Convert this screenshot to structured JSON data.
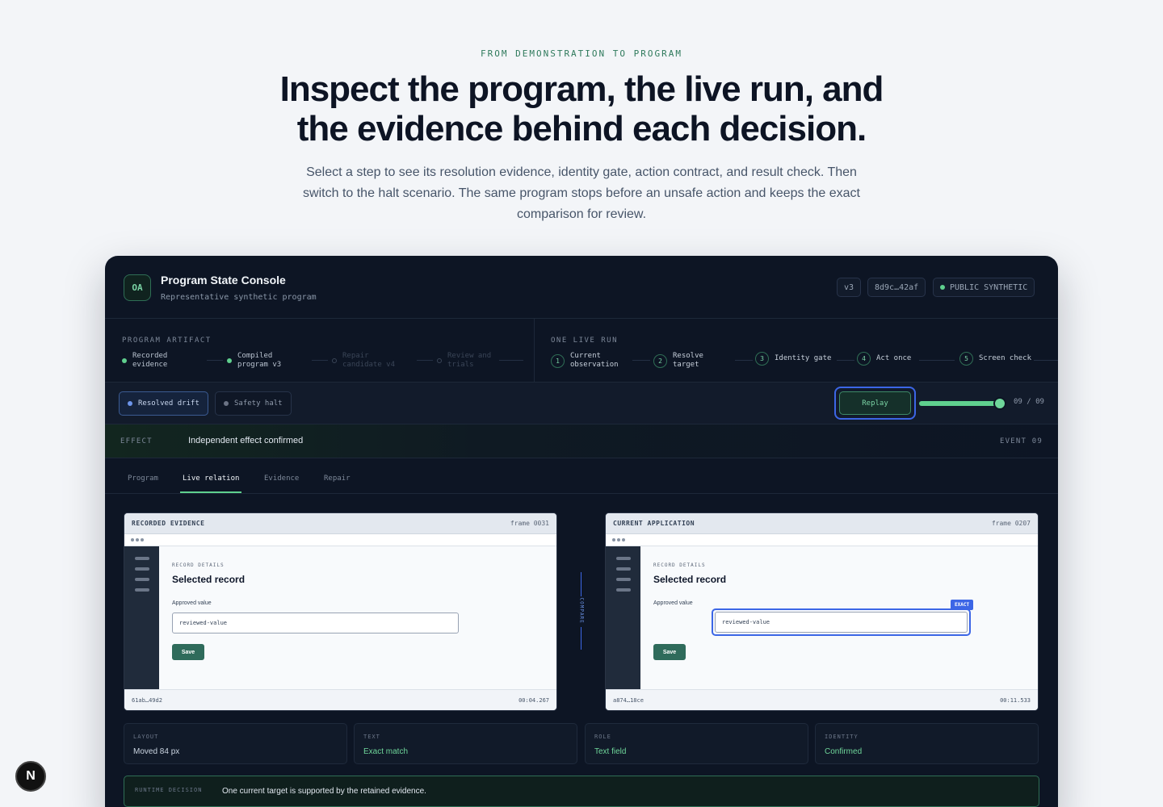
{
  "hero": {
    "eyebrow": "FROM DEMONSTRATION TO PROGRAM",
    "headline": "Inspect the program, the live run, and the evidence behind each decision.",
    "lede": "Select a step to see its resolution evidence, identity gate, action contract, and result check. Then switch to the halt scenario. The same program stops before an unsafe action and keeps the exact comparison for review."
  },
  "console": {
    "logo": "OA",
    "title": "Program State Console",
    "subtitle": "Representative synthetic program",
    "version": "v3",
    "hash": "8d9c…42af",
    "visibility": "PUBLIC SYNTHETIC",
    "accent_color": "#5fd08e",
    "focus_color": "#3c66e6"
  },
  "artifact": {
    "label": "PROGRAM ARTIFACT",
    "steps": [
      {
        "l1": "Recorded",
        "l2": "evidence",
        "state": "done"
      },
      {
        "l1": "Compiled",
        "l2": "program v3",
        "state": "done"
      },
      {
        "l1": "Repair",
        "l2": "candidate v4",
        "state": "inactive"
      },
      {
        "l1": "Review and",
        "l2": "trials",
        "state": "inactive"
      }
    ]
  },
  "run": {
    "label": "ONE LIVE RUN",
    "steps": [
      {
        "n": "1",
        "l1": "Current",
        "l2": "observation"
      },
      {
        "n": "2",
        "l1": "Resolve",
        "l2": "target"
      },
      {
        "n": "3",
        "l1": "Identity gate",
        "l2": ""
      },
      {
        "n": "4",
        "l1": "Act once",
        "l2": ""
      },
      {
        "n": "5",
        "l1": "Screen check",
        "l2": ""
      }
    ]
  },
  "toolbar": {
    "scenario_resolved": "Resolved drift",
    "scenario_halt": "Safety halt",
    "selected_scenario": "Resolved drift",
    "replay": "Replay",
    "progress": 1.0,
    "counter": "09 / 09"
  },
  "effect": {
    "label": "EFFECT",
    "value": "Independent effect confirmed",
    "event": "EVENT 09"
  },
  "tabs": [
    "Program",
    "Live relation",
    "Evidence",
    "Repair"
  ],
  "active_tab": "Live relation",
  "recorded": {
    "title": "RECORDED EVIDENCE",
    "frame": "frame 0031",
    "section": "RECORD DETAILS",
    "heading": "Selected record",
    "field_label": "Approved value",
    "field_value": "reviewed-value",
    "save": "Save",
    "hash": "61ab…49d2",
    "time": "00:04.267"
  },
  "current": {
    "title": "CURRENT APPLICATION",
    "frame": "frame 0207",
    "section": "RECORD DETAILS",
    "heading": "Selected record",
    "field_label": "Approved value",
    "field_value": "reviewed-value",
    "badge": "EXACT",
    "save": "Save",
    "hash": "a874…18ce",
    "time": "00:11.533"
  },
  "compare_label": "COMPARE",
  "attributes": [
    {
      "key": "LAYOUT",
      "value": "Moved 84 px"
    },
    {
      "key": "TEXT",
      "value": "Exact match"
    },
    {
      "key": "ROLE",
      "value": "Text field"
    },
    {
      "key": "IDENTITY",
      "value": "Confirmed"
    }
  ],
  "decision": {
    "label": "RUNTIME DECISION",
    "value": "One current target is supported by the retained evidence."
  },
  "corner_badge": "N"
}
